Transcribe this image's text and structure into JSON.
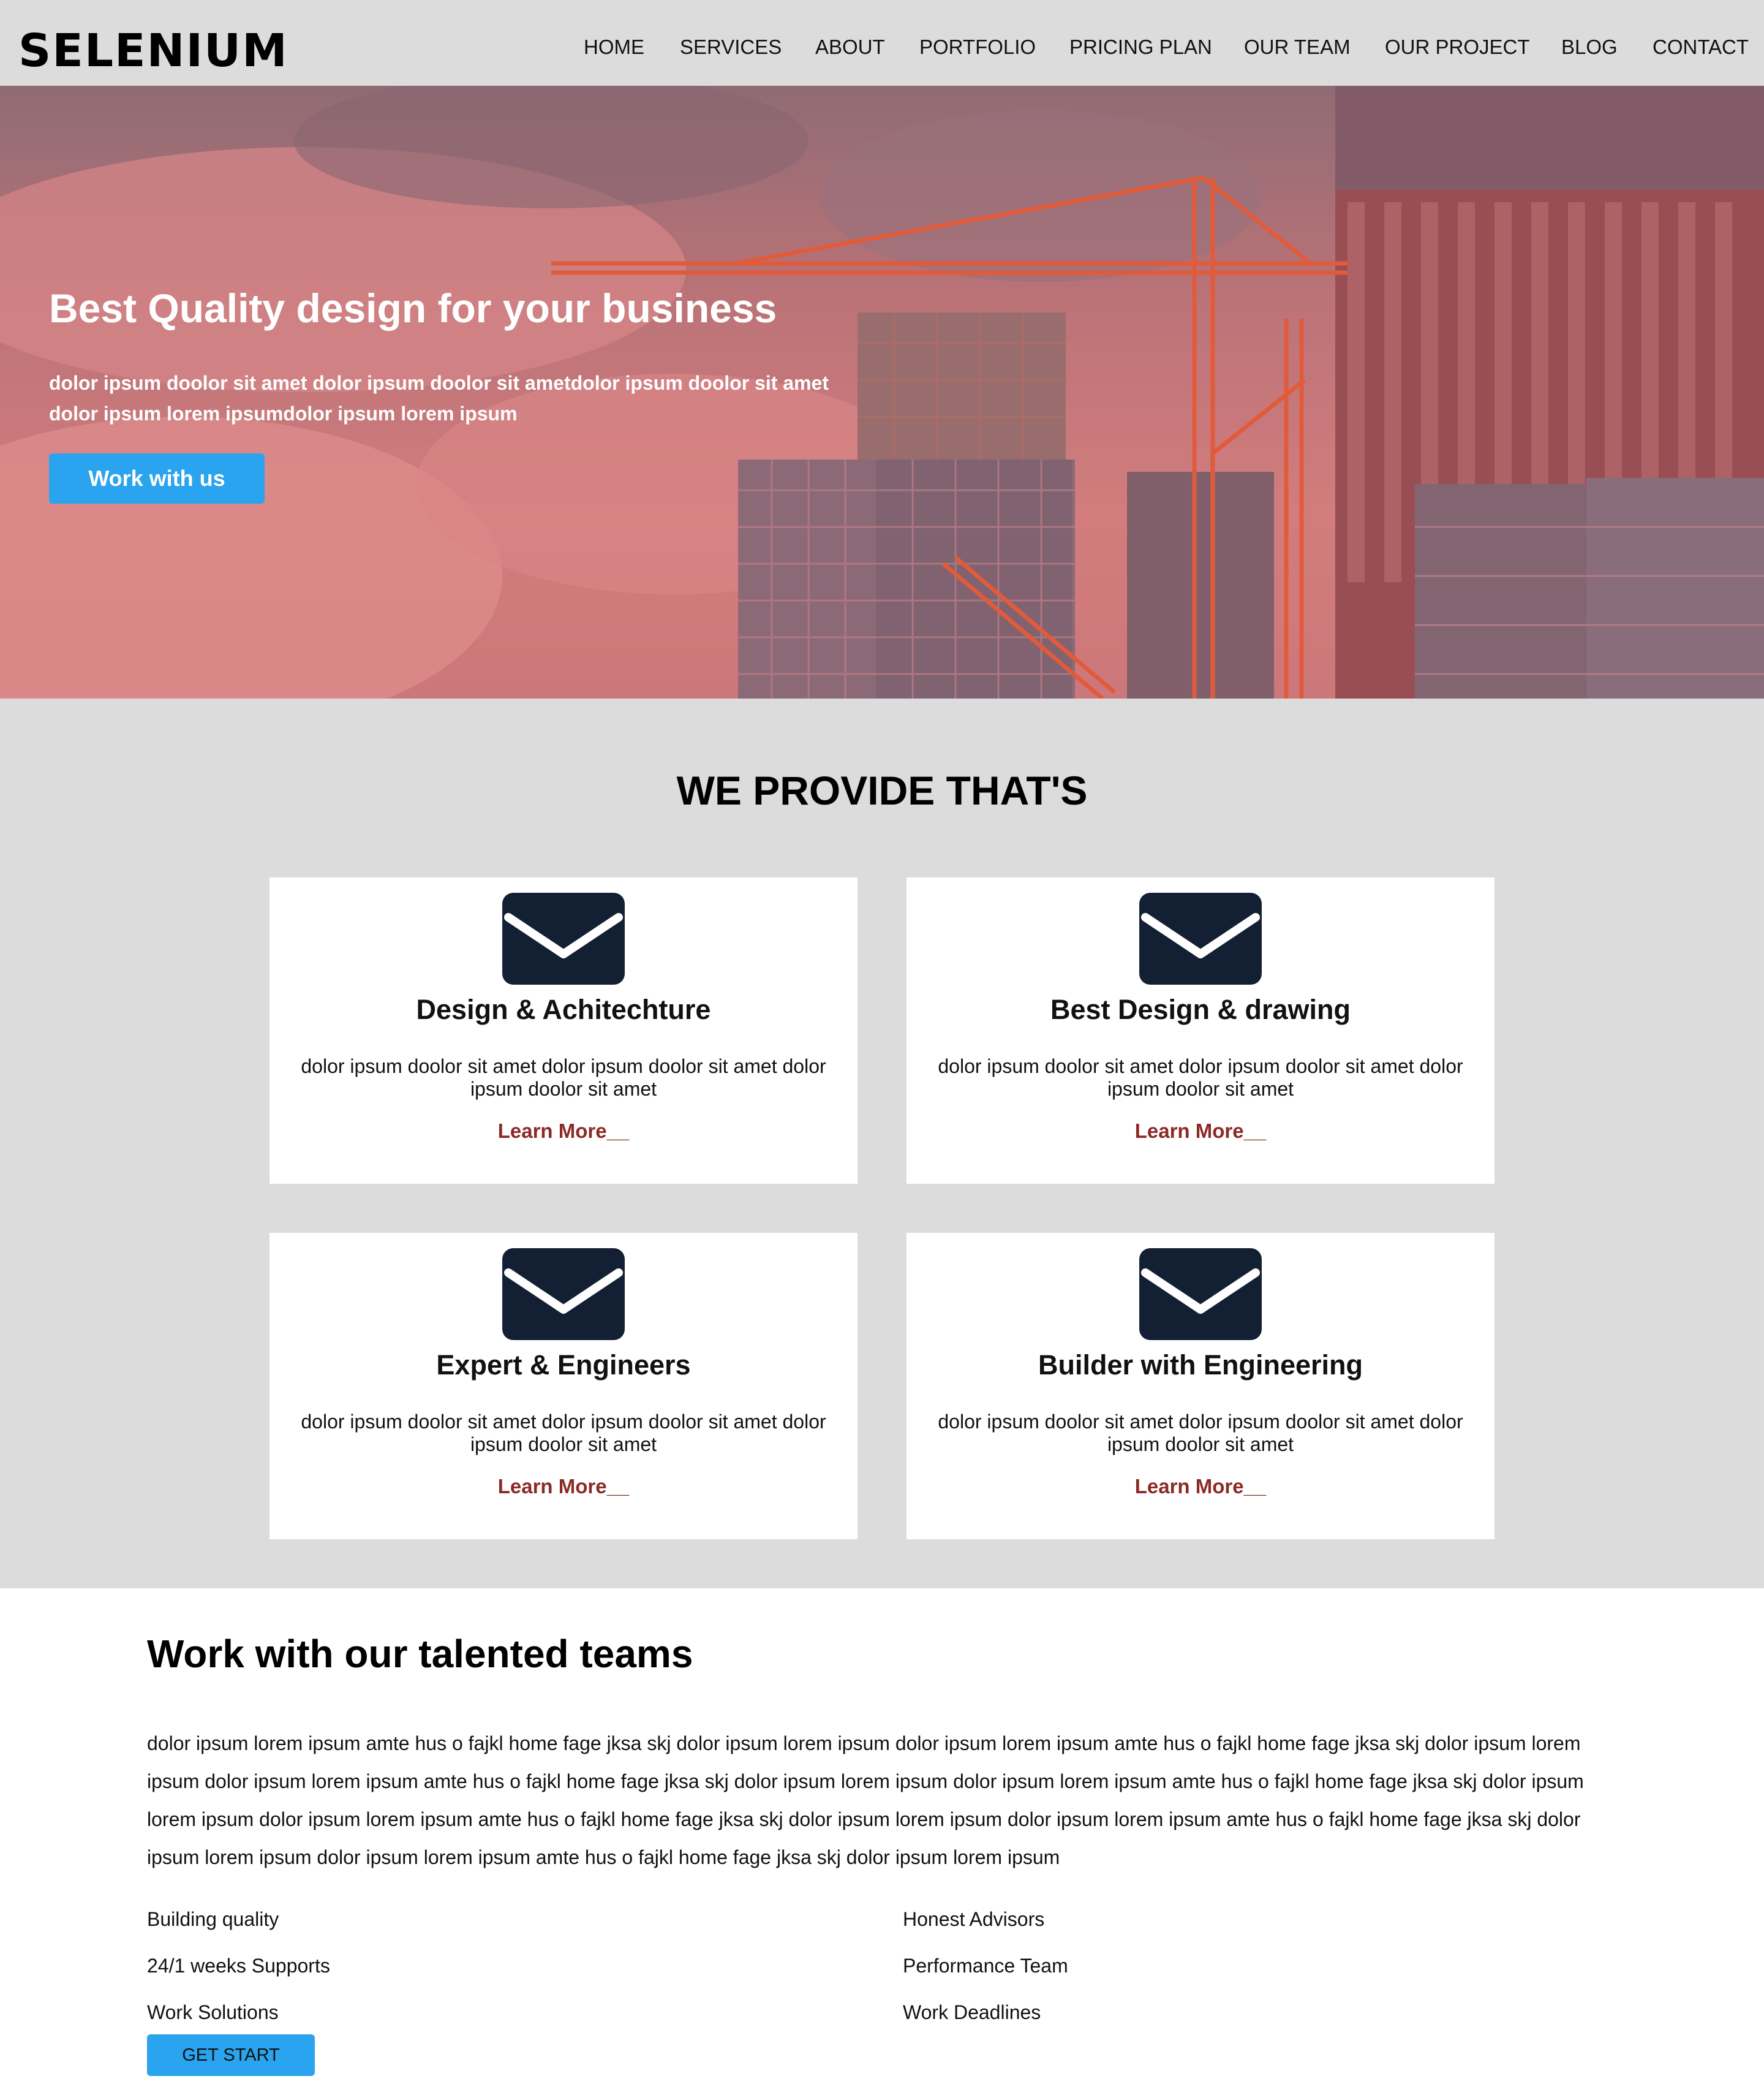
{
  "header": {
    "logo": "SELENIUM",
    "nav": [
      "HOME",
      "SERVICES",
      "ABOUT",
      "PORTFOLIO",
      "PRICING PLAN",
      "OUR TEAM",
      "OUR PROJECT",
      "BLOG",
      "CONTACT"
    ]
  },
  "hero": {
    "title": "Best Quality design for your business",
    "text": "dolor ipsum doolor sit amet dolor ipsum doolor sit ametdolor ipsum doolor sit amet dolor ipsum lorem ipsumdolor ipsum lorem ipsum",
    "button": "Work with us"
  },
  "services": {
    "title": "WE PROVIDE THAT'S",
    "cards": [
      {
        "icon": "envelope-icon",
        "title": "Design & Achitechture",
        "text": "dolor ipsum doolor sit amet dolor ipsum doolor sit amet dolor ipsum doolor sit amet",
        "link": "Learn More__"
      },
      {
        "icon": "envelope-icon",
        "title": "Best Design & drawing",
        "text": "dolor ipsum doolor sit amet dolor ipsum doolor sit amet dolor ipsum doolor sit amet",
        "link": "Learn More__"
      },
      {
        "icon": "envelope-icon",
        "title": "Expert & Engineers",
        "text": "dolor ipsum doolor sit amet dolor ipsum doolor sit amet dolor ipsum doolor sit amet",
        "link": "Learn More__"
      },
      {
        "icon": "envelope-icon",
        "title": "Builder with Engineering",
        "text": "dolor ipsum doolor sit amet dolor ipsum doolor sit amet dolor ipsum doolor sit amet",
        "link": "Learn More__"
      }
    ]
  },
  "teams": {
    "title": "Work with our talented teams",
    "text": "dolor ipsum lorem ipsum amte hus o fajkl home fage jksa skj dolor ipsum lorem ipsum dolor ipsum lorem ipsum amte hus o fajkl home fage jksa skj dolor ipsum lorem ipsum dolor ipsum lorem ipsum amte hus o fajkl home fage jksa skj dolor ipsum lorem ipsum dolor ipsum lorem ipsum amte hus o fajkl home fage jksa skj dolor ipsum lorem ipsum dolor ipsum lorem ipsum amte hus o fajkl home fage jksa skj dolor ipsum lorem ipsum dolor ipsum lorem ipsum amte hus o fajkl home fage jksa skj dolor ipsum lorem ipsum dolor ipsum lorem ipsum amte hus o fajkl home fage jksa skj dolor ipsum lorem ipsum",
    "features_left": [
      "Building quality",
      "24/1 weeks Supports",
      "Work Solutions"
    ],
    "features_right": [
      "Honest Advisors",
      "Performance Team",
      "Work Deadlines"
    ],
    "button": "GET START"
  },
  "colors": {
    "header_bg": "#dcdcdc",
    "accent_button": "#2aa4ee",
    "link_red": "#8b2a26",
    "icon_navy": "#132033",
    "hero_overlay": "#d07a7a"
  }
}
